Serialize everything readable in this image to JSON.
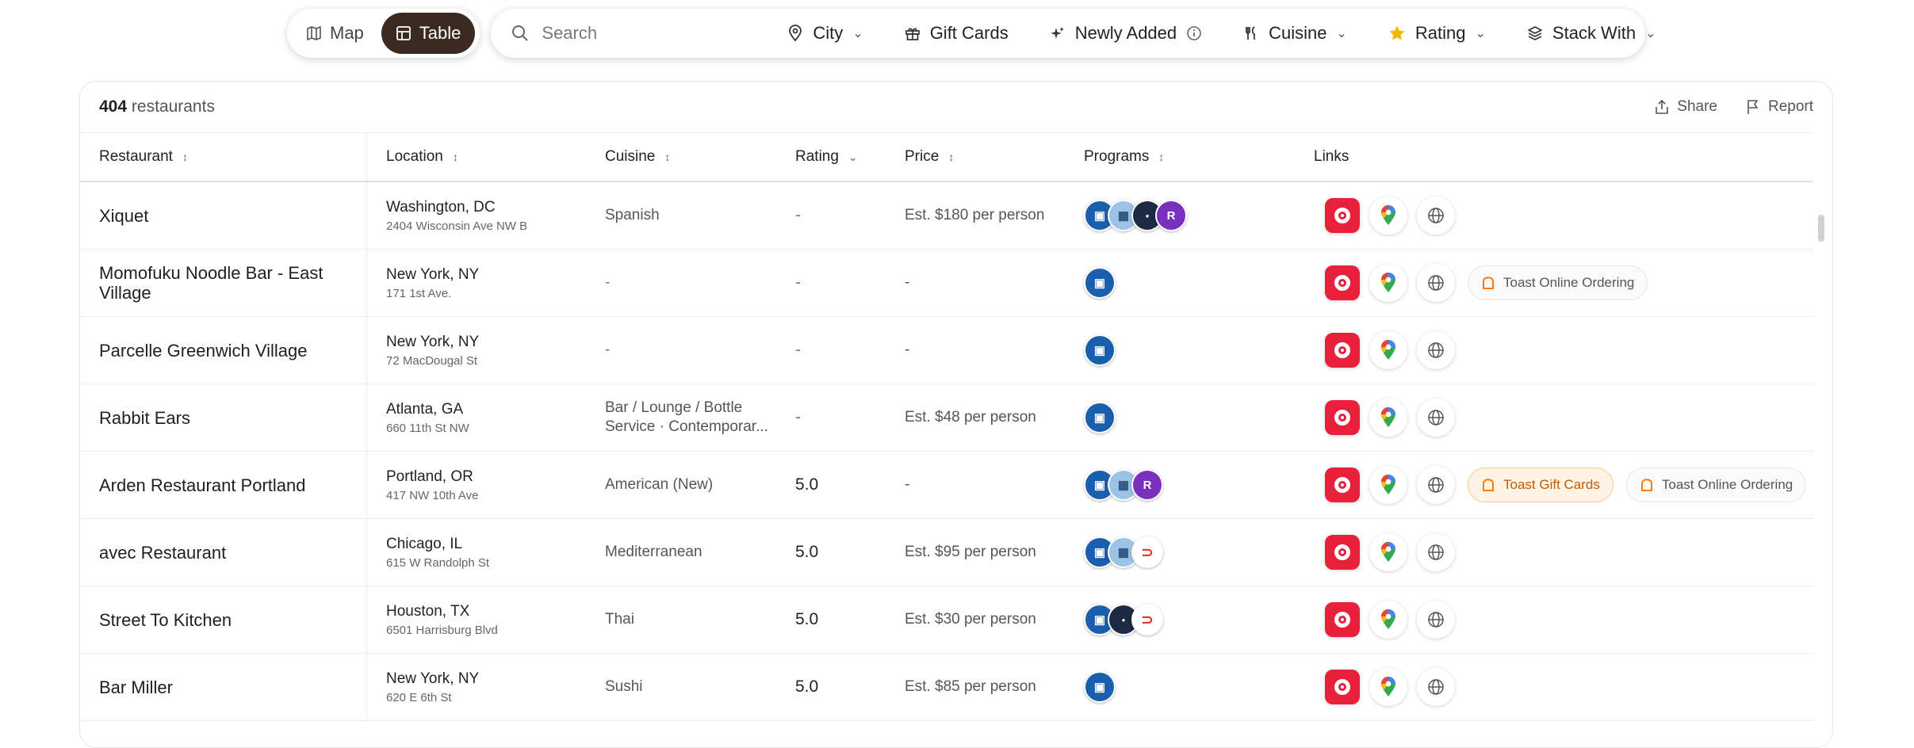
{
  "view_toggle": {
    "map_label": "Map",
    "table_label": "Table",
    "active": "Table"
  },
  "filters": {
    "search_placeholder": "Search",
    "city": "City",
    "gift_cards": "Gift Cards",
    "newly_added": "Newly Added",
    "cuisine": "Cuisine",
    "rating": "Rating",
    "stack_with": "Stack With"
  },
  "summary": {
    "count": "404",
    "count_suffix": "restaurants",
    "share": "Share",
    "report": "Report"
  },
  "columns": {
    "restaurant": "Restaurant",
    "location": "Location",
    "cuisine": "Cuisine",
    "rating": "Rating",
    "price": "Price",
    "programs": "Programs",
    "links": "Links"
  },
  "rows": [
    {
      "name": "Xiquet",
      "city": "Washington, DC",
      "address": "2404 Wisconsin Ave NW B",
      "cuisine": "Spanish",
      "rating": "-",
      "price": "Est. $180 per person"
    },
    {
      "name": "Momofuku Noodle Bar - East Village",
      "city": "New York, NY",
      "address": "171 1st Ave.",
      "cuisine": "-",
      "rating": "-",
      "price": "-",
      "pill1": "Toast Online Ordering"
    },
    {
      "name": "Parcelle Greenwich Village",
      "city": "New York, NY",
      "address": "72 MacDougal St",
      "cuisine": "-",
      "rating": "-",
      "price": "-"
    },
    {
      "name": "Rabbit Ears",
      "city": "Atlanta, GA",
      "address": "660 11th St NW",
      "cuisine": "Bar / Lounge / Bottle Service · Contemporar...",
      "rating": "-",
      "price": "Est. $48 per person"
    },
    {
      "name": "Arden Restaurant Portland",
      "city": "Portland, OR",
      "address": "417 NW 10th Ave",
      "cuisine": "American (New)",
      "rating": "5.0",
      "price": "-",
      "pill1": "Toast Gift Cards",
      "pill2": "Toast Online Ordering"
    },
    {
      "name": "avec Restaurant",
      "city": "Chicago, IL",
      "address": "615 W Randolph St",
      "cuisine": "Mediterranean",
      "rating": "5.0",
      "price": "Est. $95 per person"
    },
    {
      "name": "Street To Kitchen",
      "city": "Houston, TX",
      "address": "6501 Harrisburg Blvd",
      "cuisine": "Thai",
      "rating": "5.0",
      "price": "Est. $30 per person"
    },
    {
      "name": "Bar Miller",
      "city": "New York, NY",
      "address": "620 E 6th St",
      "cuisine": "Sushi",
      "rating": "5.0",
      "price": "Est. $85 per person"
    }
  ],
  "colors": {
    "toggle_active": "#3a2a20",
    "opentable": "#e8203c",
    "chase": "#1a5fae",
    "rating_star": "#f5b800",
    "toast_orange": "#ff7a00"
  }
}
